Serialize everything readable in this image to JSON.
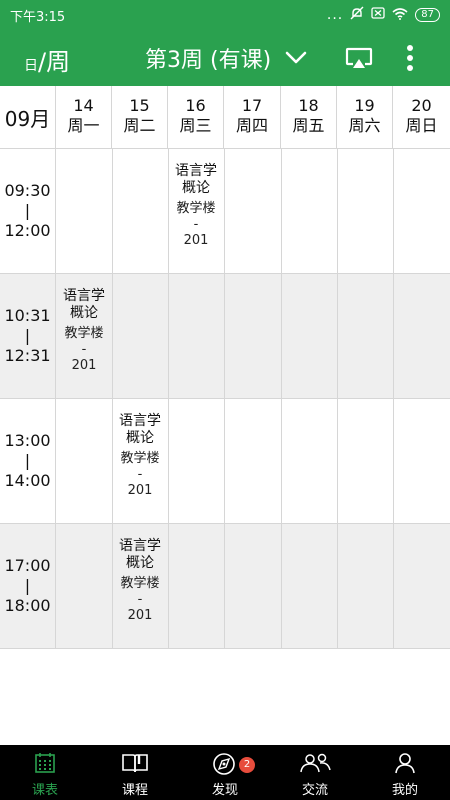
{
  "status_bar": {
    "time": "下午3:15",
    "dots": "...",
    "battery": "87"
  },
  "header": {
    "view_small": "日",
    "view_big": "/周",
    "week_title": "第3周 (有课)"
  },
  "date_row": {
    "month": "09月",
    "days": [
      {
        "date": "14",
        "weekday": "周一"
      },
      {
        "date": "15",
        "weekday": "周二"
      },
      {
        "date": "16",
        "weekday": "周三"
      },
      {
        "date": "17",
        "weekday": "周四"
      },
      {
        "date": "18",
        "weekday": "周五"
      },
      {
        "date": "19",
        "weekday": "周六"
      },
      {
        "date": "20",
        "weekday": "周日"
      }
    ]
  },
  "time_slots": [
    {
      "start": "09:30",
      "sep": "|",
      "end": "12:00"
    },
    {
      "start": "10:31",
      "sep": "|",
      "end": "12:31"
    },
    {
      "start": "13:00",
      "sep": "|",
      "end": "14:00"
    },
    {
      "start": "17:00",
      "sep": "|",
      "end": "18:00"
    }
  ],
  "courses": [
    {
      "name": "语言学概论",
      "building": "教学楼",
      "sep": "-",
      "room": "201"
    },
    {
      "name": "语言学概论",
      "building": "教学楼",
      "sep": "-",
      "room": "201"
    },
    {
      "name": "语言学概论",
      "building": "教学楼",
      "sep": "-",
      "room": "201"
    },
    {
      "name": "语言学概论",
      "building": "教学楼",
      "sep": "-",
      "room": "201"
    }
  ],
  "bottom_nav": {
    "items": [
      {
        "label": "课表",
        "icon": "calendar-grid-icon"
      },
      {
        "label": "课程",
        "icon": "book-icon"
      },
      {
        "label": "发现",
        "icon": "compass-icon",
        "badge": "2"
      },
      {
        "label": "交流",
        "icon": "people-icon"
      },
      {
        "label": "我的",
        "icon": "person-icon"
      }
    ]
  },
  "colors": {
    "primary": "#2aa14f",
    "alt_row": "#efefef",
    "badge": "#e74c3c"
  }
}
